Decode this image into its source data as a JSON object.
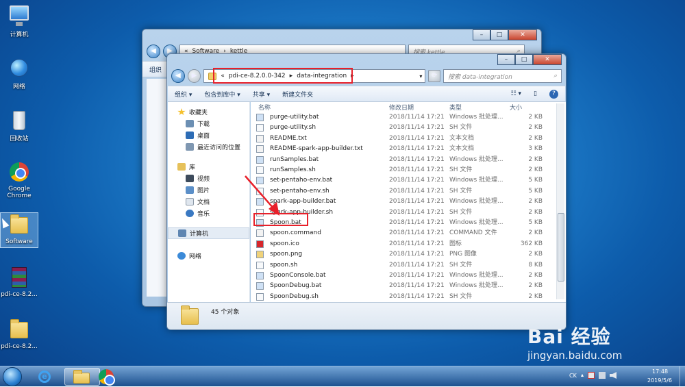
{
  "desktop": {
    "icons": [
      {
        "label": "计算机",
        "icon": "computer-icon"
      },
      {
        "label": "网络",
        "icon": "network-icon"
      },
      {
        "label": "回收站",
        "icon": "recycle-bin-icon"
      },
      {
        "label": "Google Chrome",
        "icon": "chrome-icon"
      },
      {
        "label": "Software",
        "icon": "folder-icon"
      },
      {
        "label": "pdi-ce-8.2...",
        "icon": "winrar-archive-icon"
      },
      {
        "label": "pdi-ce-8.2...",
        "icon": "folder-icon"
      }
    ]
  },
  "back_window": {
    "address": {
      "separator": "«",
      "crumbs": [
        "Software",
        "kettle"
      ]
    },
    "search_placeholder": "搜索 kettle",
    "cmd_first": "组织"
  },
  "front_window": {
    "address": {
      "separator": "«",
      "crumbs": [
        "pdi-ce-8.2.0.0-342",
        "data-integration"
      ]
    },
    "search_placeholder": "搜索 data-integration",
    "commands": {
      "organize": "组织 ▾",
      "include_library": "包含到库中 ▾",
      "share": "共享 ▾",
      "new_folder": "新建文件夹"
    },
    "nav": {
      "favorites": "收藏夹",
      "downloads": "下载",
      "desktop": "桌面",
      "recent": "最近访问的位置",
      "libraries": "库",
      "videos": "视频",
      "pictures": "图片",
      "documents": "文档",
      "music": "音乐",
      "computer": "计算机",
      "network": "网络"
    },
    "columns": {
      "name": "名称",
      "modified": "修改日期",
      "type": "类型",
      "size": "大小"
    },
    "files": [
      {
        "name": "purge-utility.bat",
        "date": "2018/11/14 17:21",
        "type": "Windows 批处理...",
        "size": "2 KB"
      },
      {
        "name": "purge-utility.sh",
        "date": "2018/11/14 17:21",
        "type": "SH 文件",
        "size": "2 KB"
      },
      {
        "name": "README.txt",
        "date": "2018/11/14 17:21",
        "type": "文本文档",
        "size": "2 KB"
      },
      {
        "name": "README-spark-app-builder.txt",
        "date": "2018/11/14 17:21",
        "type": "文本文档",
        "size": "3 KB"
      },
      {
        "name": "runSamples.bat",
        "date": "2018/11/14 17:21",
        "type": "Windows 批处理...",
        "size": "2 KB"
      },
      {
        "name": "runSamples.sh",
        "date": "2018/11/14 17:21",
        "type": "SH 文件",
        "size": "2 KB"
      },
      {
        "name": "set-pentaho-env.bat",
        "date": "2018/11/14 17:21",
        "type": "Windows 批处理...",
        "size": "5 KB"
      },
      {
        "name": "set-pentaho-env.sh",
        "date": "2018/11/14 17:21",
        "type": "SH 文件",
        "size": "5 KB"
      },
      {
        "name": "spark-app-builder.bat",
        "date": "2018/11/14 17:21",
        "type": "Windows 批处理...",
        "size": "2 KB"
      },
      {
        "name": "spark-app-builder.sh",
        "date": "2018/11/14 17:21",
        "type": "SH 文件",
        "size": "2 KB"
      },
      {
        "name": "Spoon.bat",
        "date": "2018/11/14 17:21",
        "type": "Windows 批处理...",
        "size": "5 KB"
      },
      {
        "name": "spoon.command",
        "date": "2018/11/14 17:21",
        "type": "COMMAND 文件",
        "size": "2 KB"
      },
      {
        "name": "spoon.ico",
        "date": "2018/11/14 17:21",
        "type": "图标",
        "size": "362 KB"
      },
      {
        "name": "spoon.png",
        "date": "2018/11/14 17:21",
        "type": "PNG 图像",
        "size": "2 KB"
      },
      {
        "name": "spoon.sh",
        "date": "2018/11/14 17:21",
        "type": "SH 文件",
        "size": "8 KB"
      },
      {
        "name": "SpoonConsole.bat",
        "date": "2018/11/14 17:21",
        "type": "Windows 批处理...",
        "size": "2 KB"
      },
      {
        "name": "SpoonDebug.bat",
        "date": "2018/11/14 17:21",
        "type": "Windows 批处理...",
        "size": "2 KB"
      },
      {
        "name": "SpoonDebug.sh",
        "date": "2018/11/14 17:21",
        "type": "SH 文件",
        "size": "2 KB"
      }
    ],
    "status": "45 个对象"
  },
  "taskbar": {
    "apps": [
      "start-orb-icon",
      "internet-explorer-icon",
      "file-explorer-icon",
      "chrome-icon"
    ],
    "tray": {
      "language": "CK",
      "time": "17:48",
      "date": "2019/5/6"
    }
  },
  "watermark": {
    "text": "Bai 经验",
    "url": "jingyan.baidu.com"
  },
  "annotation_color": "#e8202a"
}
